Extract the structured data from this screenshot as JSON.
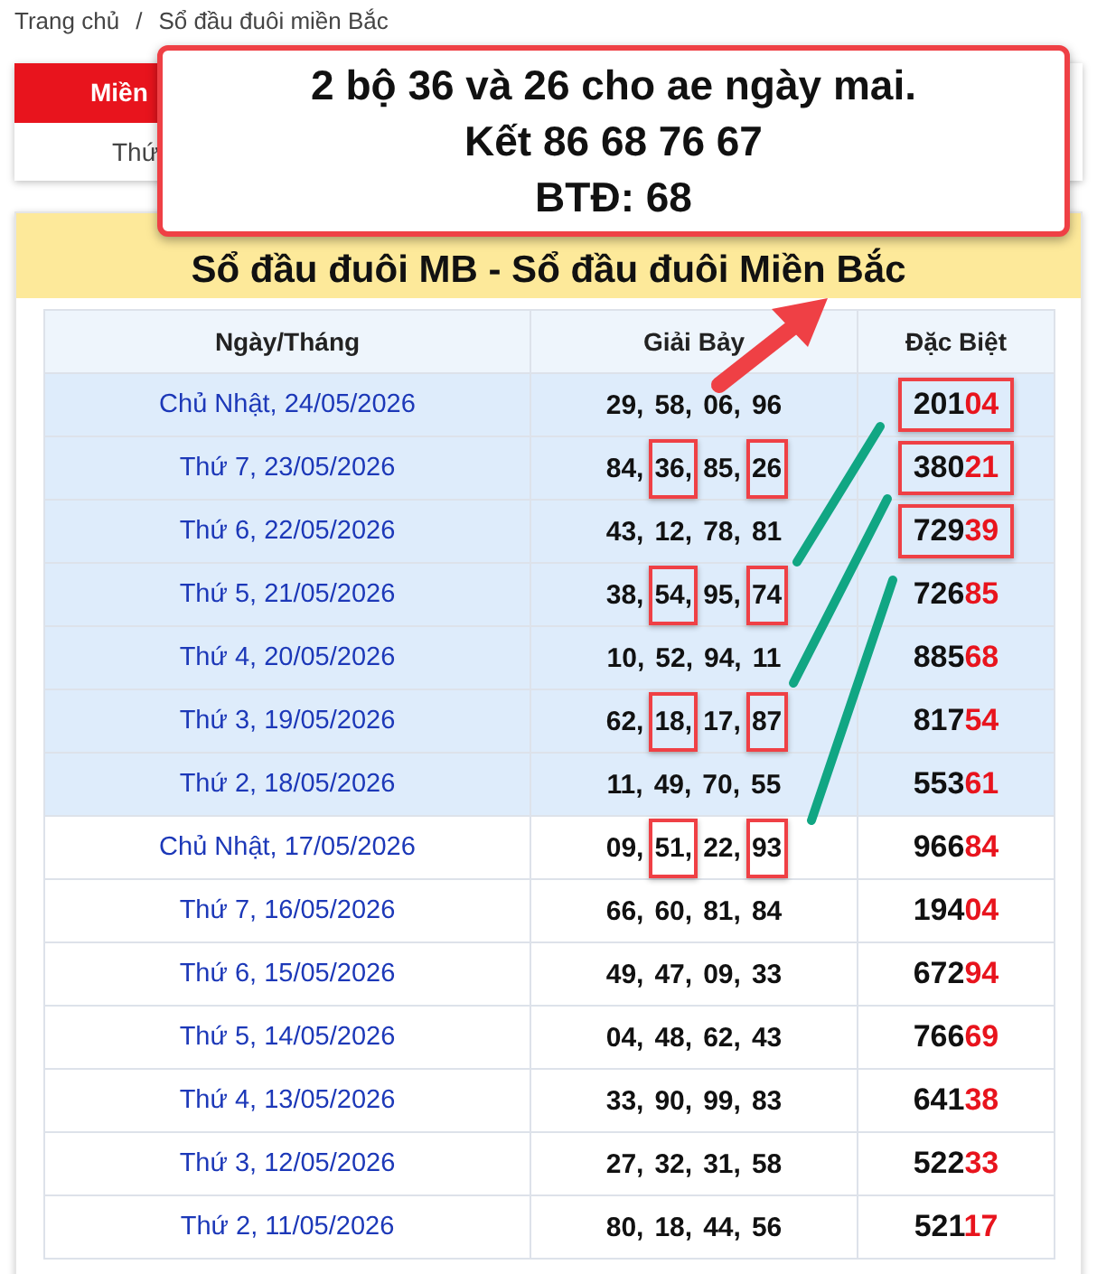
{
  "breadcrumb": [
    "Trang chủ",
    "/",
    "Sổ đầu đuôi miền Bắc"
  ],
  "region_tabs": [
    {
      "label": "Miền",
      "selected": true
    }
  ],
  "day_row": "Thứ",
  "callout": {
    "lines": [
      "2 bộ 36 và 26 cho ae ngày mai.",
      "Kết 86 68 76 67",
      "BTĐ: 68"
    ]
  },
  "title": "Sổ đầu đuôi MB - Sổ đầu đuôi Miền Bắc",
  "table": {
    "columns": [
      "Ngày/Tháng",
      "Giải Bảy",
      "Đặc Biệt"
    ],
    "rows": [
      {
        "date": "Chủ Nhật, 24/05/2026",
        "highlighted": true,
        "giai_bay": [
          {
            "text": "29,",
            "boxed": false
          },
          {
            "text": "58,",
            "boxed": false
          },
          {
            "text": "06,",
            "boxed": false
          },
          {
            "text": "96",
            "boxed": false
          }
        ],
        "dac_biet": {
          "head": "201",
          "tail": "04",
          "boxed": true
        }
      },
      {
        "date": "Thứ 7, 23/05/2026",
        "highlighted": true,
        "giai_bay": [
          {
            "text": "84,",
            "boxed": false
          },
          {
            "text": "36,",
            "boxed": true
          },
          {
            "text": "85,",
            "boxed": false
          },
          {
            "text": "26",
            "boxed": true
          }
        ],
        "dac_biet": {
          "head": "380",
          "tail": "21",
          "boxed": true
        }
      },
      {
        "date": "Thứ 6, 22/05/2026",
        "highlighted": true,
        "giai_bay": [
          {
            "text": "43,",
            "boxed": false
          },
          {
            "text": "12,",
            "boxed": false
          },
          {
            "text": "78,",
            "boxed": false
          },
          {
            "text": "81",
            "boxed": false
          }
        ],
        "dac_biet": {
          "head": "729",
          "tail": "39",
          "boxed": true
        }
      },
      {
        "date": "Thứ 5, 21/05/2026",
        "highlighted": true,
        "giai_bay": [
          {
            "text": "38,",
            "boxed": false
          },
          {
            "text": "54,",
            "boxed": true
          },
          {
            "text": "95,",
            "boxed": false
          },
          {
            "text": "74",
            "boxed": true
          }
        ],
        "dac_biet": {
          "head": "726",
          "tail": "85",
          "boxed": false
        }
      },
      {
        "date": "Thứ 4, 20/05/2026",
        "highlighted": true,
        "giai_bay": [
          {
            "text": "10,",
            "boxed": false
          },
          {
            "text": "52,",
            "boxed": false
          },
          {
            "text": "94,",
            "boxed": false
          },
          {
            "text": "11",
            "boxed": false
          }
        ],
        "dac_biet": {
          "head": "885",
          "tail": "68",
          "boxed": false
        }
      },
      {
        "date": "Thứ 3, 19/05/2026",
        "highlighted": true,
        "giai_bay": [
          {
            "text": "62,",
            "boxed": false
          },
          {
            "text": "18,",
            "boxed": true
          },
          {
            "text": "17,",
            "boxed": false
          },
          {
            "text": "87",
            "boxed": true
          }
        ],
        "dac_biet": {
          "head": "817",
          "tail": "54",
          "boxed": false
        }
      },
      {
        "date": "Thứ 2, 18/05/2026",
        "highlighted": true,
        "giai_bay": [
          {
            "text": "11,",
            "boxed": false
          },
          {
            "text": "49,",
            "boxed": false
          },
          {
            "text": "70,",
            "boxed": false
          },
          {
            "text": "55",
            "boxed": false
          }
        ],
        "dac_biet": {
          "head": "553",
          "tail": "61",
          "boxed": false
        }
      },
      {
        "date": "Chủ Nhật, 17/05/2026",
        "highlighted": false,
        "giai_bay": [
          {
            "text": "09,",
            "boxed": false
          },
          {
            "text": "51,",
            "boxed": true
          },
          {
            "text": "22,",
            "boxed": false
          },
          {
            "text": "93",
            "boxed": true
          }
        ],
        "dac_biet": {
          "head": "966",
          "tail": "84",
          "boxed": false
        }
      },
      {
        "date": "Thứ 7, 16/05/2026",
        "highlighted": false,
        "giai_bay": [
          {
            "text": "66,",
            "boxed": false
          },
          {
            "text": "60,",
            "boxed": false
          },
          {
            "text": "81,",
            "boxed": false
          },
          {
            "text": "84",
            "boxed": false
          }
        ],
        "dac_biet": {
          "head": "194",
          "tail": "04",
          "boxed": false
        }
      },
      {
        "date": "Thứ 6, 15/05/2026",
        "highlighted": false,
        "giai_bay": [
          {
            "text": "49,",
            "boxed": false
          },
          {
            "text": "47,",
            "boxed": false
          },
          {
            "text": "09,",
            "boxed": false
          },
          {
            "text": "33",
            "boxed": false
          }
        ],
        "dac_biet": {
          "head": "672",
          "tail": "94",
          "boxed": false
        }
      },
      {
        "date": "Thứ 5, 14/05/2026",
        "highlighted": false,
        "giai_bay": [
          {
            "text": "04,",
            "boxed": false
          },
          {
            "text": "48,",
            "boxed": false
          },
          {
            "text": "62,",
            "boxed": false
          },
          {
            "text": "43",
            "boxed": false
          }
        ],
        "dac_biet": {
          "head": "766",
          "tail": "69",
          "boxed": false
        }
      },
      {
        "date": "Thứ 4, 13/05/2026",
        "highlighted": false,
        "giai_bay": [
          {
            "text": "33,",
            "boxed": false
          },
          {
            "text": "90,",
            "boxed": false
          },
          {
            "text": "99,",
            "boxed": false
          },
          {
            "text": "83",
            "boxed": false
          }
        ],
        "dac_biet": {
          "head": "641",
          "tail": "38",
          "boxed": false
        }
      },
      {
        "date": "Thứ 3, 12/05/2026",
        "highlighted": false,
        "giai_bay": [
          {
            "text": "27,",
            "boxed": false
          },
          {
            "text": "32,",
            "boxed": false
          },
          {
            "text": "31,",
            "boxed": false
          },
          {
            "text": "58",
            "boxed": false
          }
        ],
        "dac_biet": {
          "head": "522",
          "tail": "33",
          "boxed": false
        }
      },
      {
        "date": "Thứ 2, 11/05/2026",
        "highlighted": false,
        "giai_bay": [
          {
            "text": "80,",
            "boxed": false
          },
          {
            "text": "18,",
            "boxed": false
          },
          {
            "text": "44,",
            "boxed": false
          },
          {
            "text": "56",
            "boxed": false
          }
        ],
        "dac_biet": {
          "head": "521",
          "tail": "17",
          "boxed": false
        }
      }
    ]
  }
}
